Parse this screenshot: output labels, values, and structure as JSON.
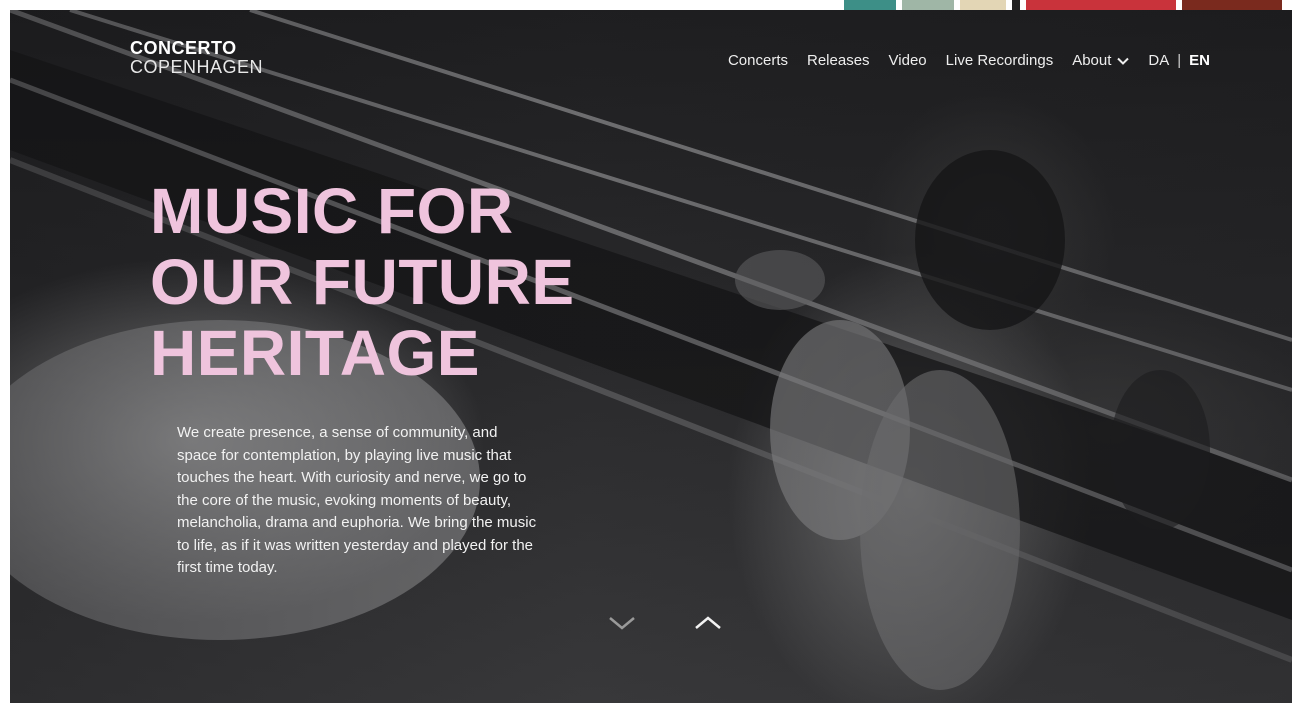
{
  "logo": {
    "line1": "CONCERTO",
    "line2": "COPENHAGEN"
  },
  "nav": {
    "items": [
      {
        "label": "Concerts"
      },
      {
        "label": "Releases"
      },
      {
        "label": "Video"
      },
      {
        "label": "Live Recordings"
      },
      {
        "label": "About"
      }
    ],
    "language": {
      "da": "DA",
      "separator": "|",
      "en": "EN",
      "active": "EN"
    }
  },
  "hero": {
    "headline": [
      "MUSIC FOR",
      "OUR FUTURE",
      "HERITAGE"
    ],
    "intro": "We create presence, a sense of community, and space for contemplation, by playing live music that touches the heart. With curiosity and nerve, we go to the core of the music, evoking moments of beauty, melancholia, drama and euphoria. We bring the music to life, as if it was written yesterday and played for the first time today.",
    "scroll_down_icon": "chevron-down-icon",
    "scroll_up_icon": "chevron-up-icon"
  },
  "colors": {
    "headline": "#efc4dd",
    "text": "#f2f2f2",
    "background": "#ffffff",
    "hero_dark": "#1f1f21"
  }
}
